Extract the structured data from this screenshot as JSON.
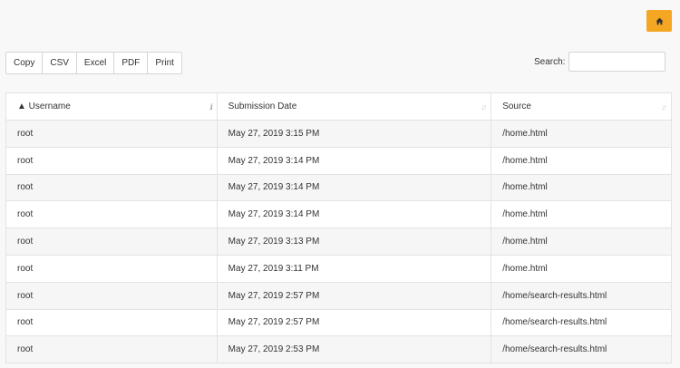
{
  "toolbar": {
    "home_icon": "home-icon",
    "accent": "#f5a623",
    "buttons": [
      "Copy",
      "CSV",
      "Excel",
      "PDF",
      "Print"
    ]
  },
  "search": {
    "label": "Search:",
    "value": "",
    "placeholder": ""
  },
  "table": {
    "headers": [
      "▲ Username",
      "Submission Date",
      "Source"
    ],
    "sort_icons": [
      "sort-asc-icon",
      "sort-icon",
      "sort-icon"
    ],
    "rows": [
      [
        "root",
        "May 27, 2019 3:15 PM",
        "/home.html"
      ],
      [
        "root",
        "May 27, 2019 3:14 PM",
        "/home.html"
      ],
      [
        "root",
        "May 27, 2019 3:14 PM",
        "/home.html"
      ],
      [
        "root",
        "May 27, 2019 3:14 PM",
        "/home.html"
      ],
      [
        "root",
        "May 27, 2019 3:13 PM",
        "/home.html"
      ],
      [
        "root",
        "May 27, 2019 3:11 PM",
        "/home.html"
      ],
      [
        "root",
        "May 27, 2019 2:57 PM",
        "/home/search-results.html"
      ],
      [
        "root",
        "May 27, 2019 2:57 PM",
        "/home/search-results.html"
      ],
      [
        "root",
        "May 27, 2019 2:53 PM",
        "/home/search-results.html"
      ]
    ]
  }
}
